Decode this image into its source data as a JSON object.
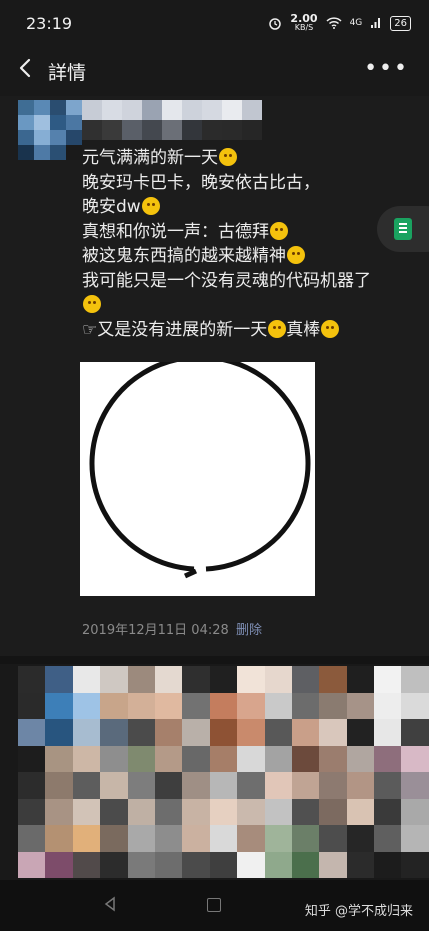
{
  "statusbar": {
    "time": "23:19",
    "net_speed": "2.00",
    "net_unit": "KB/S",
    "signal": "4G",
    "battery": "26",
    "icons": [
      "alarm-icon",
      "wifi-icon",
      "signal-icon",
      "battery-icon"
    ]
  },
  "header": {
    "title": "詳情",
    "back_icon": "chevron-left-icon",
    "more_icon": "more-horizontal-icon",
    "more_label": "•••"
  },
  "post": {
    "lines": [
      {
        "text": "元气满满的新一天",
        "emoji": true
      },
      {
        "text": "晚安玛卡巴卡，晚安依古比古，",
        "emoji": false
      },
      {
        "text": "晚安dw",
        "emoji": true
      },
      {
        "text": "真想和你说一声：古德拜",
        "emoji": true
      },
      {
        "text": "被这鬼东西搞的越来越精神",
        "emoji": true
      },
      {
        "text": "我可能只是一个没有灵魂的代码机器了",
        "emoji": false
      },
      {
        "text": "",
        "emoji": true
      }
    ],
    "last_line_prefix": "☞",
    "last_line_a": "又是没有进展的新一天",
    "last_line_b": "真棒",
    "date": "2019年12月11日 04:28",
    "delete_label": "删除"
  },
  "watermark": "知乎 @学不成归来",
  "colors": {
    "background": "#191919",
    "link": "#7f8fb5",
    "emoji": "#f4c20d",
    "accent_green": "#1aa260"
  }
}
